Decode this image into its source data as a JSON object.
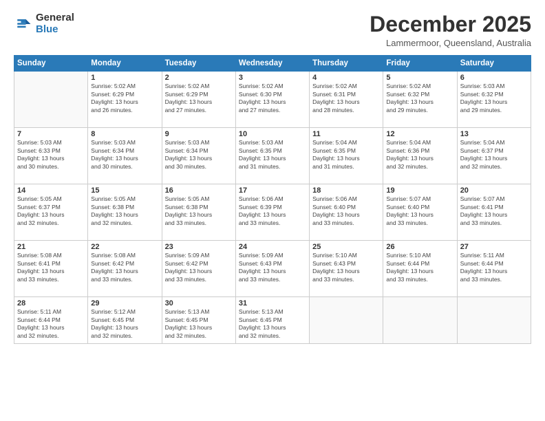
{
  "header": {
    "logo_general": "General",
    "logo_blue": "Blue",
    "month_title": "December 2025",
    "location": "Lammermoor, Queensland, Australia"
  },
  "weekdays": [
    "Sunday",
    "Monday",
    "Tuesday",
    "Wednesday",
    "Thursday",
    "Friday",
    "Saturday"
  ],
  "weeks": [
    [
      {
        "day": "",
        "info": ""
      },
      {
        "day": "1",
        "info": "Sunrise: 5:02 AM\nSunset: 6:29 PM\nDaylight: 13 hours\nand 26 minutes."
      },
      {
        "day": "2",
        "info": "Sunrise: 5:02 AM\nSunset: 6:29 PM\nDaylight: 13 hours\nand 27 minutes."
      },
      {
        "day": "3",
        "info": "Sunrise: 5:02 AM\nSunset: 6:30 PM\nDaylight: 13 hours\nand 27 minutes."
      },
      {
        "day": "4",
        "info": "Sunrise: 5:02 AM\nSunset: 6:31 PM\nDaylight: 13 hours\nand 28 minutes."
      },
      {
        "day": "5",
        "info": "Sunrise: 5:02 AM\nSunset: 6:32 PM\nDaylight: 13 hours\nand 29 minutes."
      },
      {
        "day": "6",
        "info": "Sunrise: 5:03 AM\nSunset: 6:32 PM\nDaylight: 13 hours\nand 29 minutes."
      }
    ],
    [
      {
        "day": "7",
        "info": "Sunrise: 5:03 AM\nSunset: 6:33 PM\nDaylight: 13 hours\nand 30 minutes."
      },
      {
        "day": "8",
        "info": "Sunrise: 5:03 AM\nSunset: 6:34 PM\nDaylight: 13 hours\nand 30 minutes."
      },
      {
        "day": "9",
        "info": "Sunrise: 5:03 AM\nSunset: 6:34 PM\nDaylight: 13 hours\nand 30 minutes."
      },
      {
        "day": "10",
        "info": "Sunrise: 5:03 AM\nSunset: 6:35 PM\nDaylight: 13 hours\nand 31 minutes."
      },
      {
        "day": "11",
        "info": "Sunrise: 5:04 AM\nSunset: 6:35 PM\nDaylight: 13 hours\nand 31 minutes."
      },
      {
        "day": "12",
        "info": "Sunrise: 5:04 AM\nSunset: 6:36 PM\nDaylight: 13 hours\nand 32 minutes."
      },
      {
        "day": "13",
        "info": "Sunrise: 5:04 AM\nSunset: 6:37 PM\nDaylight: 13 hours\nand 32 minutes."
      }
    ],
    [
      {
        "day": "14",
        "info": "Sunrise: 5:05 AM\nSunset: 6:37 PM\nDaylight: 13 hours\nand 32 minutes."
      },
      {
        "day": "15",
        "info": "Sunrise: 5:05 AM\nSunset: 6:38 PM\nDaylight: 13 hours\nand 32 minutes."
      },
      {
        "day": "16",
        "info": "Sunrise: 5:05 AM\nSunset: 6:38 PM\nDaylight: 13 hours\nand 33 minutes."
      },
      {
        "day": "17",
        "info": "Sunrise: 5:06 AM\nSunset: 6:39 PM\nDaylight: 13 hours\nand 33 minutes."
      },
      {
        "day": "18",
        "info": "Sunrise: 5:06 AM\nSunset: 6:40 PM\nDaylight: 13 hours\nand 33 minutes."
      },
      {
        "day": "19",
        "info": "Sunrise: 5:07 AM\nSunset: 6:40 PM\nDaylight: 13 hours\nand 33 minutes."
      },
      {
        "day": "20",
        "info": "Sunrise: 5:07 AM\nSunset: 6:41 PM\nDaylight: 13 hours\nand 33 minutes."
      }
    ],
    [
      {
        "day": "21",
        "info": "Sunrise: 5:08 AM\nSunset: 6:41 PM\nDaylight: 13 hours\nand 33 minutes."
      },
      {
        "day": "22",
        "info": "Sunrise: 5:08 AM\nSunset: 6:42 PM\nDaylight: 13 hours\nand 33 minutes."
      },
      {
        "day": "23",
        "info": "Sunrise: 5:09 AM\nSunset: 6:42 PM\nDaylight: 13 hours\nand 33 minutes."
      },
      {
        "day": "24",
        "info": "Sunrise: 5:09 AM\nSunset: 6:43 PM\nDaylight: 13 hours\nand 33 minutes."
      },
      {
        "day": "25",
        "info": "Sunrise: 5:10 AM\nSunset: 6:43 PM\nDaylight: 13 hours\nand 33 minutes."
      },
      {
        "day": "26",
        "info": "Sunrise: 5:10 AM\nSunset: 6:44 PM\nDaylight: 13 hours\nand 33 minutes."
      },
      {
        "day": "27",
        "info": "Sunrise: 5:11 AM\nSunset: 6:44 PM\nDaylight: 13 hours\nand 33 minutes."
      }
    ],
    [
      {
        "day": "28",
        "info": "Sunrise: 5:11 AM\nSunset: 6:44 PM\nDaylight: 13 hours\nand 32 minutes."
      },
      {
        "day": "29",
        "info": "Sunrise: 5:12 AM\nSunset: 6:45 PM\nDaylight: 13 hours\nand 32 minutes."
      },
      {
        "day": "30",
        "info": "Sunrise: 5:13 AM\nSunset: 6:45 PM\nDaylight: 13 hours\nand 32 minutes."
      },
      {
        "day": "31",
        "info": "Sunrise: 5:13 AM\nSunset: 6:45 PM\nDaylight: 13 hours\nand 32 minutes."
      },
      {
        "day": "",
        "info": ""
      },
      {
        "day": "",
        "info": ""
      },
      {
        "day": "",
        "info": ""
      }
    ]
  ]
}
